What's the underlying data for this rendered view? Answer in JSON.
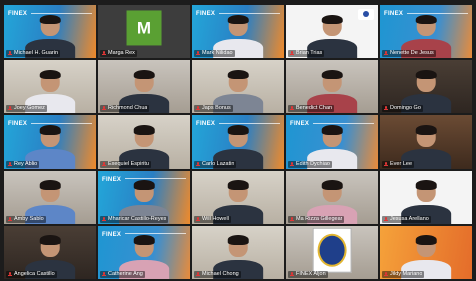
{
  "banner_logo": "FINEX",
  "participants": [
    {
      "name": "Michael H. Guarin",
      "bg": "finex"
    },
    {
      "name": "Marga Rex",
      "bg": "avatar",
      "avatar_letter": "M"
    },
    {
      "name": "Mark Nilidao",
      "bg": "finex"
    },
    {
      "name": "Brian Trias",
      "bg": "white"
    },
    {
      "name": "Nenette De Jesus",
      "bg": "finex"
    },
    {
      "name": "Joey Gomez",
      "bg": "room"
    },
    {
      "name": "Richmond Chua",
      "bg": "room2"
    },
    {
      "name": "Japs Bonus",
      "bg": "room"
    },
    {
      "name": "Benedict Chan",
      "bg": "room2"
    },
    {
      "name": "Domingo Go",
      "bg": "dark"
    },
    {
      "name": "Rey Ablio",
      "bg": "finex"
    },
    {
      "name": "Exequiel Espiritu",
      "bg": "room"
    },
    {
      "name": "Carlo Lazatin",
      "bg": "finex"
    },
    {
      "name": "Edith Dychiao",
      "bg": "finex"
    },
    {
      "name": "Ever Lee",
      "bg": "books"
    },
    {
      "name": "Amby Sablo",
      "bg": "room2"
    },
    {
      "name": "Mharicar Castillo-Reyes",
      "bg": "finex"
    },
    {
      "name": "Will Howell",
      "bg": "room"
    },
    {
      "name": "Ma Rizza Gillegear",
      "bg": "room2"
    },
    {
      "name": "Jesusa Arellano",
      "bg": "white"
    },
    {
      "name": "Angelica Castillo",
      "bg": "dark"
    },
    {
      "name": "Catherine Ang",
      "bg": "finex"
    },
    {
      "name": "Michael Chong",
      "bg": "room"
    },
    {
      "name": "FINEX Aljon",
      "bg": "logo"
    },
    {
      "name": "Jildy Mariano",
      "bg": "orange"
    }
  ],
  "colors": {
    "muted_mic": "#e03636",
    "finex_blue": "#23a6d9",
    "finex_orange": "#f08a2a",
    "avatar_green": "#5aa033"
  }
}
